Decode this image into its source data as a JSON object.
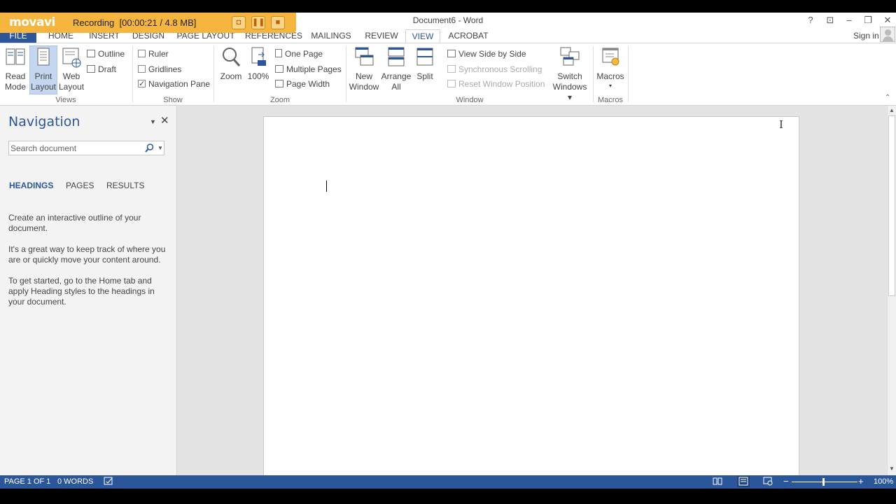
{
  "recorder": {
    "logo": "movavi",
    "status": "Recording",
    "time_size": "[00:00:21 / 4.8 MB]",
    "icons": [
      "camera-icon",
      "pause-icon",
      "stop-icon"
    ]
  },
  "window": {
    "title": "Document6 - Word",
    "help": "?",
    "ribbon_display": "⊡",
    "minimize": "–",
    "restore": "❐",
    "close": "✕"
  },
  "tabs": {
    "file": "FILE",
    "home": "HOME",
    "insert": "INSERT",
    "design": "DESIGN",
    "page_layout": "PAGE LAYOUT",
    "references": "REFERENCES",
    "mailings": "MAILINGS",
    "review": "REVIEW",
    "view": "VIEW",
    "acrobat": "ACROBAT",
    "active": "VIEW",
    "sign_in": "Sign in"
  },
  "ribbon": {
    "views": {
      "label": "Views",
      "read_mode": [
        "Read",
        "Mode"
      ],
      "print_layout": [
        "Print",
        "Layout"
      ],
      "web_layout": [
        "Web",
        "Layout"
      ],
      "outline": "Outline",
      "draft": "Draft",
      "selected": "Print Layout"
    },
    "show": {
      "label": "Show",
      "ruler": "Ruler",
      "gridlines": "Gridlines",
      "navigation_pane": "Navigation Pane",
      "checked": [
        "Navigation Pane"
      ]
    },
    "zoom": {
      "label": "Zoom",
      "zoom": "Zoom",
      "hundred": "100%",
      "one_page": "One Page",
      "multiple_pages": "Multiple Pages",
      "page_width": "Page Width"
    },
    "window": {
      "label": "Window",
      "new_window": [
        "New",
        "Window"
      ],
      "arrange_all": [
        "Arrange",
        "All"
      ],
      "split": "Split",
      "view_side_by_side": "View Side by Side",
      "synchronous_scrolling": "Synchronous Scrolling",
      "reset_window_position": "Reset Window Position",
      "switch_windows": [
        "Switch",
        "Windows ▾"
      ]
    },
    "macros": {
      "label": "Macros",
      "macros": "Macros",
      "macros_dropdown": "▾"
    },
    "collapse": "⌃"
  },
  "navigation": {
    "title": "Navigation",
    "dropdown": "▼",
    "close": "✕",
    "search_placeholder": "Search document",
    "tabs": [
      "HEADINGS",
      "PAGES",
      "RESULTS"
    ],
    "active_tab": "HEADINGS",
    "paragraphs": [
      "Create an interactive outline of your document.",
      "It's a great way to keep track of where you are or quickly move your content around.",
      "To get started, go to the Home tab and apply Heading styles to the headings in your document."
    ]
  },
  "statusbar": {
    "page": "PAGE 1 OF 1",
    "words": "0 WORDS",
    "zoom_minus": "−",
    "zoom_plus": "+",
    "zoom_level": "100%",
    "zoom_value": 100
  },
  "colors": {
    "accent": "#2b579a",
    "recorder": "#f6b53f"
  }
}
